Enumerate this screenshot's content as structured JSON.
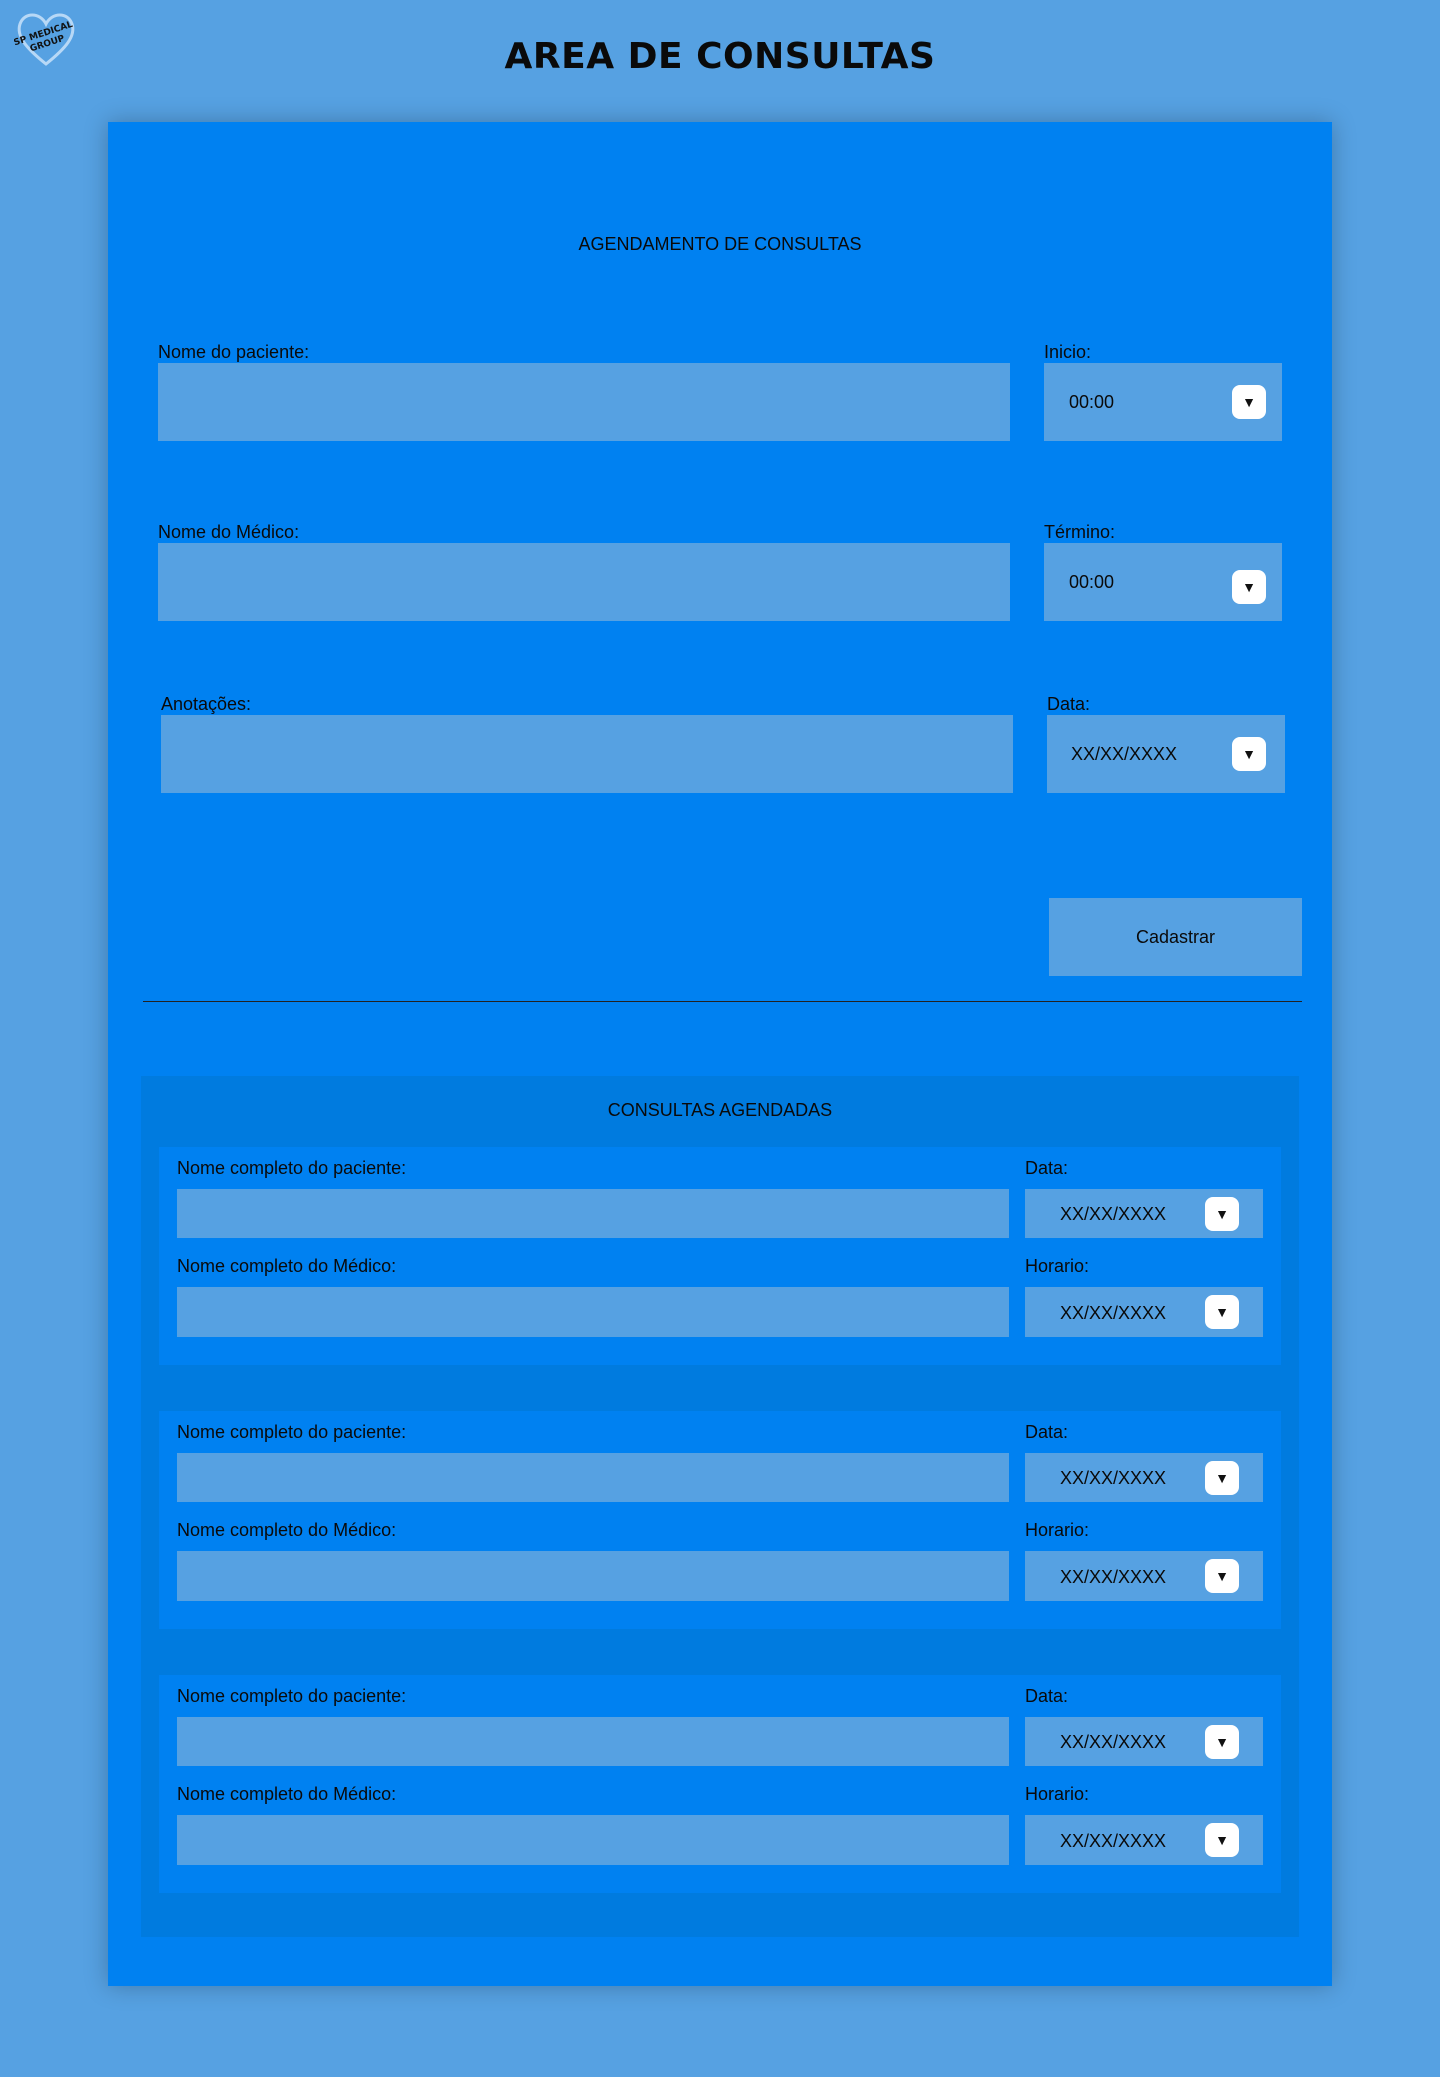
{
  "logo": {
    "line1": "SP MEDICAL",
    "line2": "GROUP"
  },
  "page_title": "AREA DE CONSULTAS",
  "form": {
    "heading": "AGENDAMENTO DE CONSULTAS",
    "patient_label": "Nome do paciente:",
    "doctor_label": "Nome do Médico:",
    "notes_label": "Anotações:",
    "start_label": "Inicio:",
    "start_value": "00:00",
    "end_label": "Término:",
    "end_value": "00:00",
    "date_label": "Data:",
    "date_value": "XX/XX/XXXX",
    "submit_label": "Cadastrar"
  },
  "list": {
    "heading": "CONSULTAS AGENDADAS",
    "cards": [
      {
        "patient_label": "Nome completo do paciente:",
        "doctor_label": "Nome completo do Médico:",
        "date_label": "Data:",
        "date_value": "XX/XX/XXXX",
        "time_label": "Horario:",
        "time_value": "XX/XX/XXXX"
      },
      {
        "patient_label": "Nome completo do paciente:",
        "doctor_label": "Nome completo do Médico:",
        "date_label": "Data:",
        "date_value": "XX/XX/XXXX",
        "time_label": "Horario:",
        "time_value": "XX/XX/XXXX"
      },
      {
        "patient_label": "Nome completo do paciente:",
        "doctor_label": "Nome completo do Médico:",
        "date_label": "Data:",
        "date_value": "XX/XX/XXXX",
        "time_label": "Horario:",
        "time_value": "XX/XX/XXXX"
      }
    ]
  },
  "icons": {
    "dropdown": "caret-down-icon",
    "logo": "heart-outline-icon"
  },
  "colors": {
    "background": "#56a1e2",
    "panel": "#0081f1",
    "list_bg": "#007bdf",
    "field": "#56a1e2"
  }
}
